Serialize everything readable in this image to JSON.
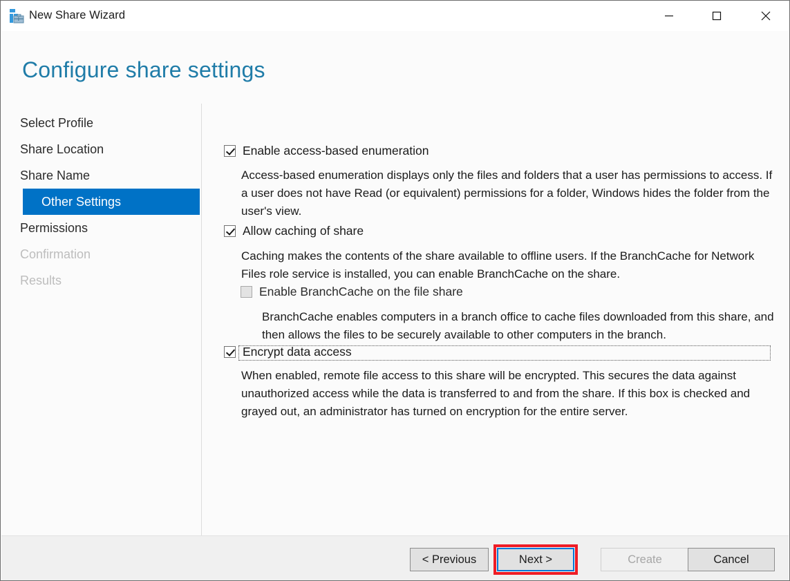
{
  "window": {
    "title": "New Share Wizard",
    "icon": "share-server-icon",
    "controls": {
      "minimize": "minimize-icon",
      "maximize": "maximize-icon",
      "close": "close-icon"
    }
  },
  "page": {
    "title": "Configure share settings",
    "title_color": "#1f7ca8"
  },
  "sidebar": {
    "items": [
      {
        "label": "Select Profile",
        "state": "completed"
      },
      {
        "label": "Share Location",
        "state": "completed"
      },
      {
        "label": "Share Name",
        "state": "completed"
      },
      {
        "label": "Other Settings",
        "state": "selected"
      },
      {
        "label": "Permissions",
        "state": "enabled"
      },
      {
        "label": "Confirmation",
        "state": "disabled"
      },
      {
        "label": "Results",
        "state": "disabled"
      }
    ],
    "selected_color": "#0072c6",
    "disabled_color": "#bdbdbd"
  },
  "settings": {
    "access_based_enumeration": {
      "label": "Enable access-based enumeration",
      "checked": true,
      "description": "Access-based enumeration displays only the files and folders that a user has permissions to access. If a user does not have Read (or equivalent) permissions for a folder, Windows hides the folder from the user's view."
    },
    "allow_caching": {
      "label": "Allow caching of share",
      "checked": true,
      "description": "Caching makes the contents of the share available to offline users. If the BranchCache for Network Files role service is installed, you can enable BranchCache on the share."
    },
    "branchcache": {
      "label": "Enable BranchCache on the file share",
      "checked": false,
      "disabled": true,
      "description": "BranchCache enables computers in a branch office to cache files downloaded from this share, and then allows the files to be securely available to other computers in the branch."
    },
    "encrypt_data_access": {
      "label": "Encrypt data access",
      "checked": true,
      "focused": true,
      "description": "When enabled, remote file access to this share will be encrypted. This secures the data against unauthorized access while the data is transferred to and from the share. If this box is checked and grayed out, an administrator has turned on encryption for the entire server."
    }
  },
  "footer": {
    "previous": "< Previous",
    "next": "Next >",
    "create": "Create",
    "cancel": "Cancel",
    "create_disabled": true,
    "next_is_default": true,
    "highlight_color": "#ee1c25"
  }
}
